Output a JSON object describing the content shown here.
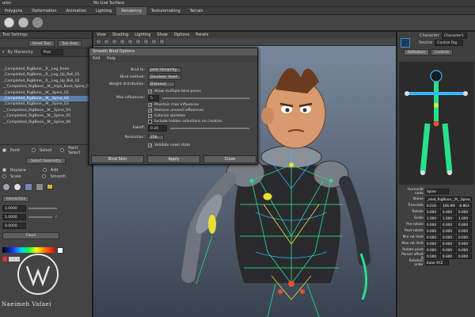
{
  "topbar": {
    "left_text": "ures",
    "center_text": "No Live Surface"
  },
  "menu": {
    "items": [
      "Polygons",
      "Deformation",
      "Animation",
      "Lighting",
      "Rendering",
      "Texturemaking",
      "Terrain"
    ],
    "active_index": 4
  },
  "left_panel": {
    "tool_settings": "Tool Settings",
    "reset_tool": "Reset Tool",
    "tool_help": "Tool Help",
    "outliner": {
      "by_hierarchy": "By Hierarchy",
      "plist": "Plist"
    },
    "outliner_items": [
      "_Completed_RigBone__R__Leg_Knee",
      "_Completed_RigBone__R__Leg_Up_Roll_01",
      "_Completed_RigBone__R__Leg_Up_Roll_02",
      "__Completed_RigBone__M__Hips_Base_Spine_Rotation",
      "_Completed_RigBone__M__Spine_01",
      "_Completed_RigBone__M__Spine_02",
      "_Completed_RigBone__M__Spine_03",
      "__Completed_RigBone__M__Spine_04",
      "__Completed_RigBone__M__Spine_05",
      "__Completed_RigBone__M__Spine_06"
    ],
    "selected_index": 5,
    "paint_label": "Paint",
    "select_label": "Select",
    "paint_select": "Paint Select",
    "select_geometry": "Select Geometry",
    "replace": "Replace",
    "add": "Add",
    "scale": "Scale",
    "smooth": "Smooth",
    "interactive": "Interactive",
    "value1": "1.0000",
    "value2": "1.0000",
    "value3": "0.0000",
    "flood": "Flood"
  },
  "viewport": {
    "menu": [
      "View",
      "Shading",
      "Lighting",
      "Show",
      "Options",
      "Panels"
    ]
  },
  "dialog": {
    "title": "Smooth Bind Options",
    "menu": [
      "Edit",
      "Help"
    ],
    "bind_to_label": "Bind to:",
    "bind_to_value": "Joint Hierarchy",
    "bind_method_label": "Bind method:",
    "bind_method_value": "Geodesic Voxel",
    "weight_distribution_label": "Weight distribution:",
    "weight_distribution_value": "Distance",
    "allow_multiple": "Allow multiple bind poses",
    "max_influences_label": "Max influences:",
    "max_influences_value": "5",
    "maintain_max": "Maintain max influences",
    "remove_unused": "Remove unused influences",
    "colorize": "Colorize skeleton",
    "include_hidden": "Include hidden selections on creation",
    "falloff_label": "Falloff:",
    "falloff_value": "0.20",
    "resolution_label": "Resolution:",
    "resolution_value": "256",
    "validate": "Validate voxel state",
    "bind_skin": "Bind Skin",
    "apply": "Apply",
    "close": "Close"
  },
  "right_panel": {
    "character_label": "Character",
    "character_value": "Character1",
    "source_label": "Source",
    "source_value": "Control Rig",
    "tabs": [
      "Definition",
      "Controls"
    ],
    "humanik_label": "HumanIK node",
    "humanik_value": "Spine",
    "attrs": [
      {
        "label": "Name",
        "values": [
          "_eted_RigBone__M__Spine_01"
        ]
      },
      {
        "label": "Translate",
        "values": [
          "0.016",
          "106.999",
          "-0.863"
        ]
      },
      {
        "label": "Rotate",
        "values": [
          "0.000",
          "0.000",
          "0.000"
        ]
      },
      {
        "label": "Scale",
        "values": [
          "1.000",
          "1.000",
          "1.000"
        ]
      },
      {
        "label": "Pre-rotate",
        "values": [
          "0.000",
          "0.000",
          "0.000"
        ]
      },
      {
        "label": "Post-rotate",
        "values": [
          "0.000",
          "0.000",
          "0.000"
        ]
      },
      {
        "label": "Min rot limit",
        "values": [
          "0.000",
          "0.000",
          "0.000"
        ]
      },
      {
        "label": "Max rot limit",
        "values": [
          "0.000",
          "0.000",
          "0.000"
        ]
      },
      {
        "label": "Rotate pivot",
        "values": [
          "0.000",
          "0.000",
          "0.000"
        ]
      },
      {
        "label": "Parent offset R",
        "values": [
          "0.000",
          "0.000",
          "0.000"
        ]
      },
      {
        "label": "Rotation order",
        "values": [
          "Euler XYZ"
        ]
      }
    ]
  },
  "watermark": {
    "text": "Naeimeh Vafaei"
  },
  "colors": {
    "selection": "#5a7fb0",
    "skeleton_green": "#28e08c",
    "skeleton_cyan": "#35b8ff",
    "skeleton_yellow": "#e8e032"
  }
}
